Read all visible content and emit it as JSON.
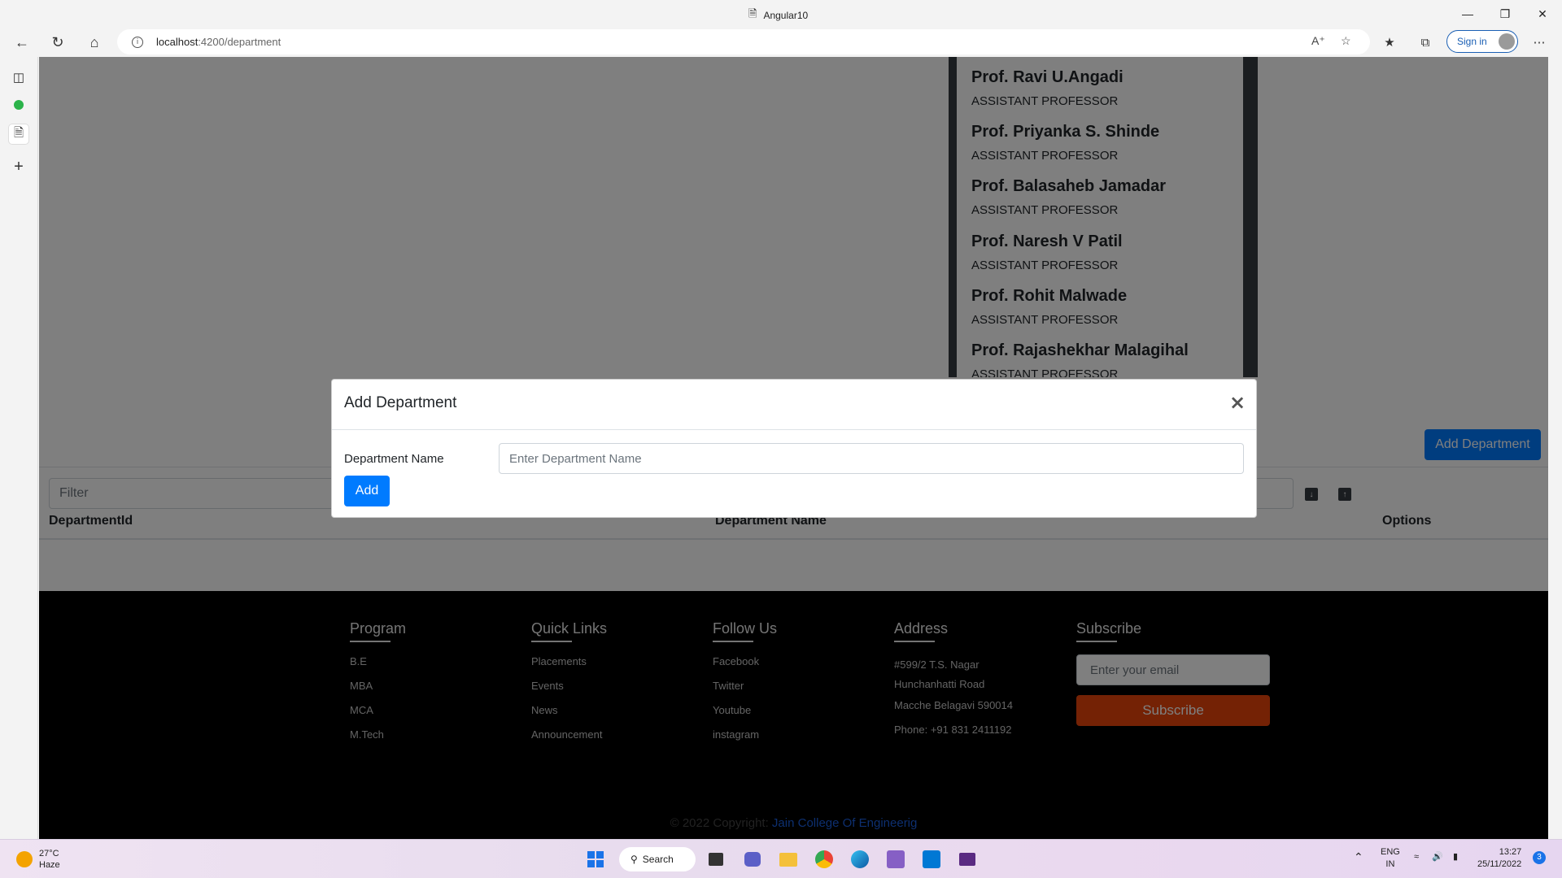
{
  "browser": {
    "tab_title": "Angular10",
    "url_host": "localhost",
    "url_path": ":4200/department",
    "signin_label": "Sign in"
  },
  "faculty": [
    {
      "name": "Prof. Ravi U.Angadi",
      "role": "ASSISTANT PROFESSOR"
    },
    {
      "name": "Prof. Priyanka S. Shinde",
      "role": "ASSISTANT PROFESSOR"
    },
    {
      "name": "Prof. Balasaheb Jamadar",
      "role": "ASSISTANT PROFESSOR"
    },
    {
      "name": "Prof. Naresh V Patil",
      "role": "ASSISTANT PROFESSOR"
    },
    {
      "name": "Prof. Rohit Malwade",
      "role": "ASSISTANT PROFESSOR"
    },
    {
      "name": "Prof. Rajashekhar Malagihal",
      "role": "ASSISTANT PROFESSOR"
    }
  ],
  "page": {
    "add_department_label": "Add Department",
    "filter_placeholder": "Filter",
    "columns": [
      "DepartmentId",
      "Department Name",
      "Options"
    ]
  },
  "footer": {
    "columns": [
      {
        "heading": "Program",
        "items": [
          "B.E",
          "MBA",
          "MCA",
          "M.Tech"
        ]
      },
      {
        "heading": "Quick Links",
        "items": [
          "Placements",
          "Events",
          "News",
          "Announcement"
        ]
      },
      {
        "heading": "Follow Us",
        "items": [
          "Facebook",
          "Twitter",
          "Youtube",
          "instagram"
        ]
      },
      {
        "heading": "Address",
        "items": [
          "#599/2 T.S. Nagar Hunchanhatti Road",
          "Macche Belagavi 590014",
          "Phone: +91 831 2411192"
        ]
      }
    ],
    "subscribe_heading": "Subscribe",
    "email_placeholder": "Enter your email",
    "subscribe_label": "Subscribe",
    "copyright_text": "© 2022 Copyright:",
    "copyright_link": "Jain College Of Engineerig"
  },
  "modal": {
    "title": "Add Department",
    "close_glyph": "×",
    "field_label": "Department Name",
    "field_placeholder": "Enter Department Name",
    "add_label": "Add"
  },
  "taskbar": {
    "temperature": "27°C",
    "weather": "Haze",
    "search_label": "Search",
    "lang_top": "ENG",
    "lang_bottom": "IN",
    "time": "13:27",
    "date": "25/11/2022",
    "notification_count": "3"
  }
}
